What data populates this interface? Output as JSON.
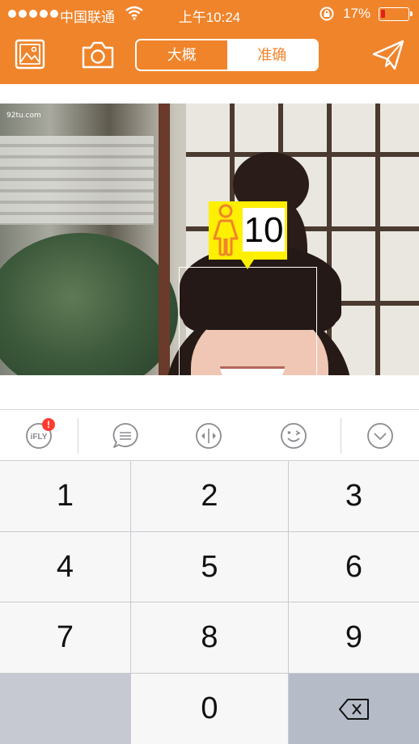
{
  "status_bar": {
    "carrier": "中国联通",
    "time": "上午10:24",
    "battery_percent": "17%",
    "battery_level": 0.17,
    "battery_color": "#e02020"
  },
  "toolbar": {
    "gallery_icon": "image-gallery-icon",
    "camera_icon": "camera-icon",
    "send_icon": "paper-plane-icon",
    "mode_rough": "大概",
    "mode_accurate": "准确",
    "selected_mode": "准确",
    "accent_color": "#f0842b"
  },
  "photo": {
    "watermark": "92tu.com",
    "face_tag": {
      "gender_icon": "female-icon",
      "age": "10",
      "tag_color": "#ffef00"
    }
  },
  "input_toolbar": {
    "items": [
      {
        "name": "ifly-icon",
        "label": "iFLY",
        "badge": "!"
      },
      {
        "name": "chat-bubble-icon"
      },
      {
        "name": "cursor-move-icon"
      },
      {
        "name": "wink-emoji-icon"
      },
      {
        "name": "chevron-down-icon"
      }
    ]
  },
  "numpad": {
    "keys": [
      "1",
      "2",
      "3",
      "4",
      "5",
      "6",
      "7",
      "8",
      "9",
      "0"
    ],
    "delete_icon": "backspace-icon"
  }
}
